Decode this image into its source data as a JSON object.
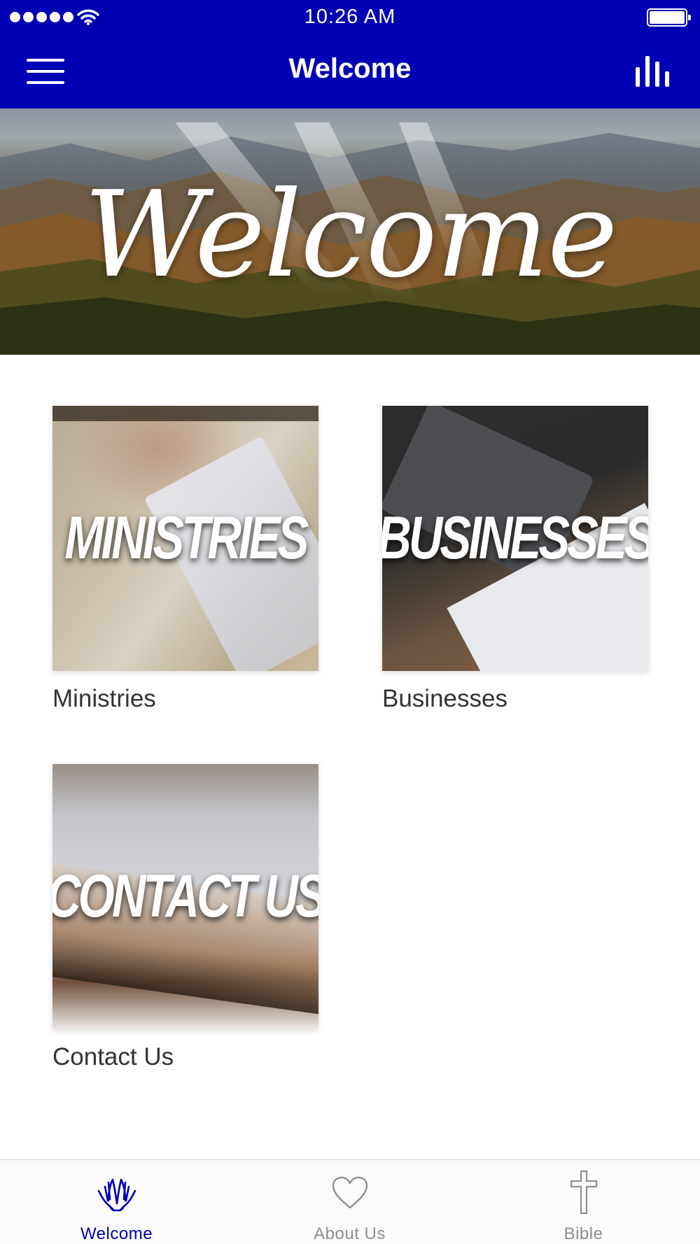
{
  "status_bar": {
    "time": "10:26 AM",
    "signal_icon": "signal-dots-icon",
    "wifi_icon": "wifi-icon",
    "battery_icon": "battery-icon",
    "battery_level": 1.0
  },
  "nav": {
    "title": "Welcome",
    "left_icon": "hamburger-menu-icon",
    "right_icon": "bar-chart-icon"
  },
  "hero": {
    "text": "Welcome"
  },
  "tiles": [
    {
      "image_text": "MINISTRIES",
      "label": "Ministries"
    },
    {
      "image_text": "BUSINESSES",
      "label": "Businesses"
    },
    {
      "image_text": "CONTACT US",
      "label": "Contact Us"
    }
  ],
  "tabbar": {
    "items": [
      {
        "label": "Welcome",
        "icon": "praying-hands-icon",
        "active": true
      },
      {
        "label": "About Us",
        "icon": "heart-icon",
        "active": false
      },
      {
        "label": "Bible",
        "icon": "cross-icon",
        "active": false
      }
    ]
  },
  "colors": {
    "brand": "#0000b4",
    "tab_inactive": "#8e8e93",
    "label_text": "#333333"
  }
}
